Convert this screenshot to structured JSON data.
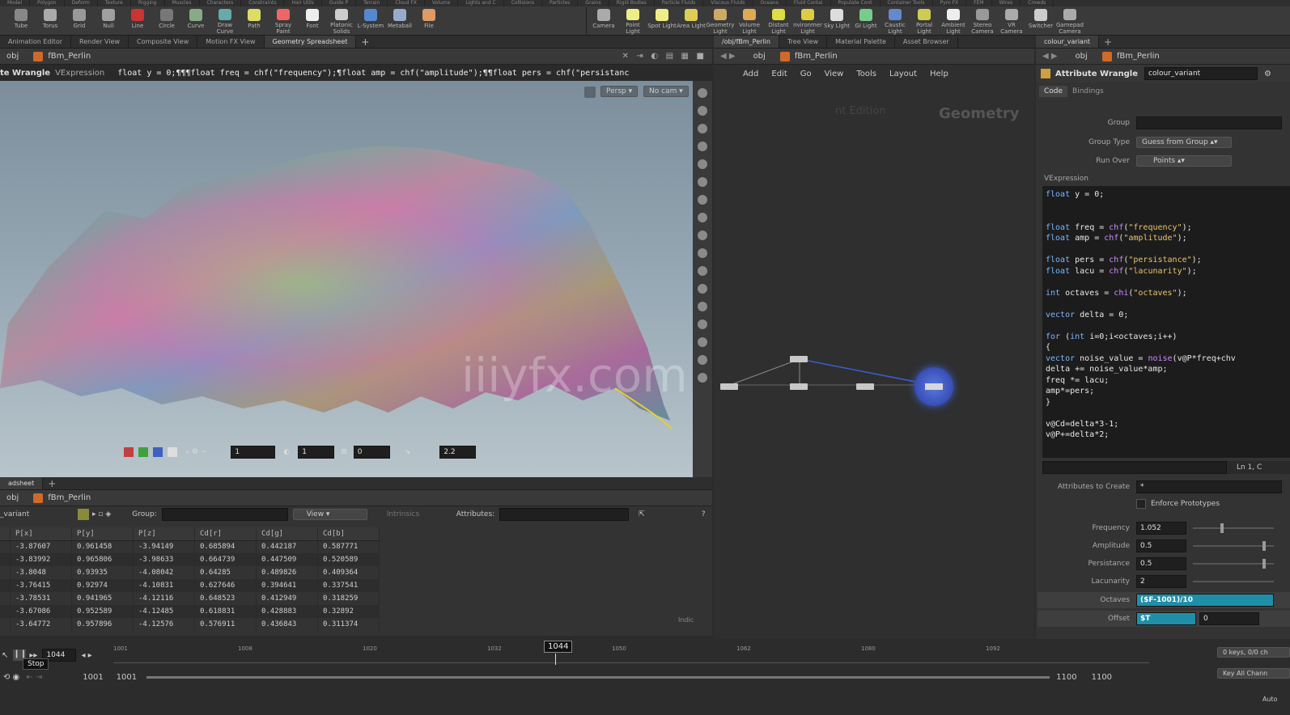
{
  "shelf": {
    "tabs": [
      "Model",
      "Polygon",
      "Deform",
      "Texture",
      "Rigging",
      "Muscles",
      "Characters",
      "Constraints",
      "Hair Utils",
      "Guide P",
      "Terrain",
      "Cloud FX",
      "Volume",
      "Lights and C",
      "Collisions",
      "Particles",
      "Grains",
      "Rigid Bodies",
      "Particle Fluids",
      "Viscous Fluids",
      "Oceans",
      "Fluid Contai",
      "Populate Cont",
      "Container Tools",
      "Pyro FX",
      "FEM",
      "Wires",
      "Crowds"
    ],
    "tools_left": [
      "Tube",
      "Torus",
      "Grid",
      "Null",
      "Line",
      "Circle",
      "Curve",
      "Draw Curve",
      "Path",
      "Spray Paint",
      "Font",
      "Platonic Solids",
      "L-System",
      "Metaball",
      "File"
    ],
    "tools_right": [
      "Camera",
      "Point Light",
      "Spot Light",
      "Area Light",
      "Geometry Light",
      "Volume Light",
      "Distant Light",
      "Environment Light",
      "Sky Light",
      "GI Light",
      "Caustic Light",
      "Portal Light",
      "Ambient Light",
      "Stereo Camera",
      "VR Camera",
      "Switcher",
      "Gamepad Camera"
    ]
  },
  "viewer": {
    "tabs": [
      "Animation Editor",
      "Render View",
      "Composite View",
      "Motion FX View",
      "Geometry Spreadsheet"
    ],
    "path_root": "obj",
    "path_node": "fBm_Perlin",
    "param_label": "te Wrangle",
    "param_type": "VExpression",
    "expression": "float y = 0;¶¶¶float freq = chf(\"frequency\");¶float amp = chf(\"amplitude\");¶¶float pers = chf(\"persistanc",
    "persp": "Persp",
    "cam": "No cam",
    "bottom_val1": "1",
    "bottom_val2": "1",
    "bottom_val3": "0",
    "bottom_val4": "2.2",
    "watermark": "iiiyfx.com"
  },
  "spreadsheet": {
    "tab": "adsheet",
    "path_root": "obj",
    "path_node": "fBm_Perlin",
    "node_name": "_variant",
    "group_label": "Group:",
    "view_label": "View",
    "intrinsics_label": "Intrinsics",
    "attributes_label": "Attributes:",
    "columns": [
      "P[x]",
      "P[y]",
      "P[z]",
      "Cd[r]",
      "Cd[g]",
      "Cd[b]"
    ],
    "rows": [
      [
        "-3.87607",
        "0.961458",
        "-3.94149",
        "0.685894",
        "0.442187",
        "0.587771"
      ],
      [
        "-3.83992",
        "0.965806",
        "-3.98633",
        "0.664739",
        "0.447509",
        "0.520589"
      ],
      [
        "-3.8048",
        "0.93935",
        "-4.08042",
        "0.64285",
        "0.489826",
        "0.409364"
      ],
      [
        "-3.76415",
        "0.92974",
        "-4.10831",
        "0.627646",
        "0.394641",
        "0.337541"
      ],
      [
        "-3.78531",
        "0.941965",
        "-4.12116",
        "0.648523",
        "0.412949",
        "0.318259"
      ],
      [
        "-3.67086",
        "0.952589",
        "-4.12485",
        "0.618831",
        "0.428883",
        "0.32892"
      ],
      [
        "-3.64772",
        "0.957896",
        "-4.12576",
        "0.576911",
        "0.436843",
        "0.311374"
      ]
    ],
    "indicator": "Indic"
  },
  "network": {
    "tabs": [
      "/obj/fBm_Perlin",
      "Tree View",
      "Material Palette",
      "Asset Browser"
    ],
    "path_root": "obj",
    "path_node": "fBm_Perlin",
    "menu": [
      "Add",
      "Edit",
      "Go",
      "View",
      "Tools",
      "Layout",
      "Help"
    ],
    "context_label": "Geometry",
    "faded_label": "nt Edition"
  },
  "params": {
    "tab": "colour_variant",
    "path_root": "obj",
    "path_node": "fBm_Perlin",
    "node_type": "Attribute Wrangle",
    "node_name": "colour_variant",
    "subtabs": [
      "Code",
      "Bindings"
    ],
    "group_label": "Group",
    "group_type_label": "Group Type",
    "group_type_value": "Guess from Group",
    "run_over_label": "Run Over",
    "run_over_value": "Points",
    "vex_label": "VExpression",
    "code_status": "Ln 1, C",
    "attrs_to_create_label": "Attributes to Create",
    "attrs_to_create_value": "*",
    "enforce_label": "Enforce Prototypes",
    "frequency_label": "Frequency",
    "frequency_value": "1.052",
    "frequency_level": 0.35,
    "amplitude_label": "Amplitude",
    "amplitude_value": "0.5",
    "amplitude_level": 0.9,
    "persistance_label": "Persistance",
    "persistance_value": "0.5",
    "persistance_level": 0.9,
    "lacunarity_label": "Lacunarity",
    "lacunarity_value": "2",
    "octaves_label": "Octaves",
    "octaves_value": "($F-1001)/10",
    "offset_label": "Offset",
    "offset_value": "$T",
    "offset_value2": "0"
  },
  "timeline": {
    "current_frame": "1044",
    "frame_marker": "1044",
    "tooltip": "Stop",
    "ticks": [
      "1001",
      "1008",
      "1020",
      "1032",
      "1050",
      "1062",
      "1080",
      "1092"
    ],
    "start1": "1001",
    "start2": "1001",
    "end1": "1100",
    "end2": "1100",
    "keys": "0 keys, 0/0 ch",
    "key_all": "Key All Chann",
    "auto": "Auto"
  },
  "colors": {
    "accent_blue": "#3a5fd0",
    "param_highlight": "#1f8fa8",
    "viewport_bg": "#9aabb7"
  }
}
